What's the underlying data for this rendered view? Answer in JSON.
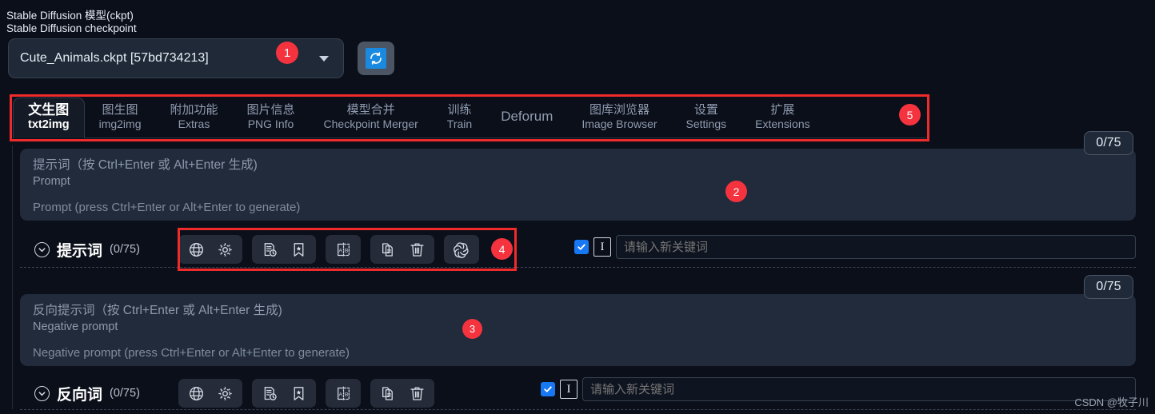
{
  "checkpoint": {
    "label_cn": "Stable Diffusion 模型(ckpt)",
    "label_en": "Stable Diffusion checkpoint",
    "value": "Cute_Animals.ckpt [57bd734213]",
    "refresh_icon": "refresh-icon",
    "caret_icon": "chevron-down-icon"
  },
  "badges": [
    {
      "id": "1",
      "text": "1"
    },
    {
      "id": "2",
      "text": "2"
    },
    {
      "id": "3",
      "text": "3"
    },
    {
      "id": "4",
      "text": "4"
    },
    {
      "id": "5",
      "text": "5"
    }
  ],
  "tabs": [
    {
      "cn": "文生图",
      "en": "txt2img",
      "active": true
    },
    {
      "cn": "图生图",
      "en": "img2img",
      "active": false
    },
    {
      "cn": "附加功能",
      "en": "Extras",
      "active": false
    },
    {
      "cn": "图片信息",
      "en": "PNG Info",
      "active": false
    },
    {
      "cn": "模型合并",
      "en": "Checkpoint Merger",
      "active": false
    },
    {
      "cn": "训练",
      "en": "Train",
      "active": false
    },
    {
      "cn": "Deforum",
      "en": "",
      "active": false
    },
    {
      "cn": "图库浏览器",
      "en": "Image Browser",
      "active": false
    },
    {
      "cn": "设置",
      "en": "Settings",
      "active": false
    },
    {
      "cn": "扩展",
      "en": "Extensions",
      "active": false
    }
  ],
  "positive": {
    "title": "提示词（按 Ctrl+Enter 或 Alt+Enter 生成)",
    "subtitle": "Prompt",
    "placeholder": "Prompt (press Ctrl+Enter or Alt+Enter to generate)",
    "counter": "0/75",
    "section_title": "提示词",
    "section_count": "(0/75)",
    "keyword_placeholder": "请输入新关键词",
    "tools": [
      {
        "group": 0,
        "name": "globe-icon"
      },
      {
        "group": 0,
        "name": "gear-icon"
      },
      {
        "group": 1,
        "name": "history-document-icon"
      },
      {
        "group": 1,
        "name": "bookmark-star-icon"
      },
      {
        "group": 2,
        "name": "ab-translate-icon"
      },
      {
        "group": 3,
        "name": "copy-document-icon"
      },
      {
        "group": 3,
        "name": "trash-icon"
      },
      {
        "group": 4,
        "name": "openai-spiral-icon"
      }
    ]
  },
  "negative": {
    "title": "反向提示词（按 Ctrl+Enter 或 Alt+Enter 生成)",
    "subtitle": "Negative prompt",
    "placeholder": "Negative prompt (press Ctrl+Enter or Alt+Enter to generate)",
    "counter": "0/75",
    "section_title": "反向词",
    "section_count": "(0/75)",
    "keyword_placeholder": "请输入新关键词",
    "tools": [
      {
        "group": 0,
        "name": "globe-icon"
      },
      {
        "group": 0,
        "name": "gear-icon"
      },
      {
        "group": 1,
        "name": "history-document-icon"
      },
      {
        "group": 1,
        "name": "bookmark-star-icon"
      },
      {
        "group": 2,
        "name": "ab-translate-icon"
      },
      {
        "group": 3,
        "name": "copy-document-icon"
      },
      {
        "group": 3,
        "name": "trash-icon"
      }
    ]
  },
  "watermark": "CSDN @牧子川",
  "colors": {
    "background": "#0b0f19",
    "panel": "#212b3b",
    "accent_red": "#f5333f",
    "accent_blue": "#1877f2",
    "frame_red": "#ef2b2b"
  }
}
